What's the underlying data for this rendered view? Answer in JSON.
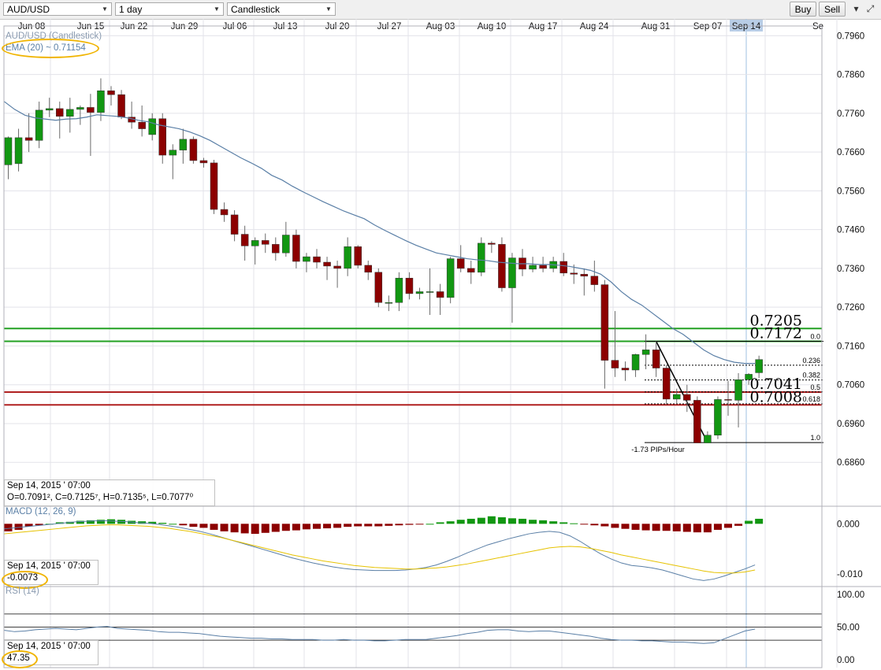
{
  "toolbar": {
    "symbol": "AUD/USD",
    "interval": "1 day",
    "chart_type": "Candlestick",
    "buy_label": "Buy",
    "sell_label": "Sell"
  },
  "main_labels": {
    "title": "AUD/USD (Candlestick)",
    "ema": "EMA (20) ~ 0.71154"
  },
  "info_main": {
    "date": "Sep 14, 2015 ' 07:00",
    "ohlc": "O=0.7091², C=0.7125⁷, H=0.7135⁵, L=0.7077⁰"
  },
  "macd_panel": {
    "label": "MACD (12, 26, 9)",
    "date": "Sep 14, 2015 ' 07:00",
    "value": "-0.0073"
  },
  "rsi_panel": {
    "label": "RSI (14)",
    "date": "Sep 14, 2015 ' 07:00",
    "value": "47.35"
  },
  "colors": {
    "bull": "#129712",
    "bear": "#8c0000",
    "ema": "#5a7fa6",
    "signal": "#e6c200",
    "support": "#b02020",
    "resistance": "#22a022",
    "highlight": "#f0b400"
  },
  "chart_data": {
    "type": "candlestick",
    "title": "AUD/USD (Candlestick)",
    "interval": "1 day",
    "x_tick_labels": [
      "Jun 08",
      "Jun 15",
      "Jun 22",
      "Jun 29",
      "Jul 06",
      "Jul 13",
      "Jul 20",
      "Jul 27",
      "Aug 03",
      "Aug 10",
      "Aug 17",
      "Aug 24",
      "Aug 31",
      "Sep 07",
      "Sep 14",
      "Se"
    ],
    "y_ticks": [
      "0.7960",
      "0.7860",
      "0.7760",
      "0.7660",
      "0.7560",
      "0.7460",
      "0.7360",
      "0.7260",
      "0.7160",
      "0.7060",
      "0.6960",
      "0.6860"
    ],
    "ylim": [
      0.683,
      0.7985
    ],
    "candles": [
      {
        "o": 0.7627,
        "h": 0.77,
        "l": 0.759,
        "c": 0.7697
      },
      {
        "o": 0.763,
        "h": 0.772,
        "l": 0.761,
        "c": 0.7697
      },
      {
        "o": 0.7697,
        "h": 0.776,
        "l": 0.766,
        "c": 0.769
      },
      {
        "o": 0.769,
        "h": 0.779,
        "l": 0.767,
        "c": 0.7768
      },
      {
        "o": 0.7768,
        "h": 0.78,
        "l": 0.775,
        "c": 0.7772
      },
      {
        "o": 0.7772,
        "h": 0.779,
        "l": 0.7695,
        "c": 0.7752
      },
      {
        "o": 0.7752,
        "h": 0.78,
        "l": 0.771,
        "c": 0.777
      },
      {
        "o": 0.777,
        "h": 0.778,
        "l": 0.773,
        "c": 0.7775
      },
      {
        "o": 0.7775,
        "h": 0.781,
        "l": 0.765,
        "c": 0.7762
      },
      {
        "o": 0.7762,
        "h": 0.785,
        "l": 0.774,
        "c": 0.7818
      },
      {
        "o": 0.7818,
        "h": 0.783,
        "l": 0.778,
        "c": 0.7808
      },
      {
        "o": 0.7808,
        "h": 0.782,
        "l": 0.7745,
        "c": 0.775
      },
      {
        "o": 0.775,
        "h": 0.779,
        "l": 0.772,
        "c": 0.7737
      },
      {
        "o": 0.7737,
        "h": 0.778,
        "l": 0.77,
        "c": 0.772
      },
      {
        "o": 0.7705,
        "h": 0.776,
        "l": 0.769,
        "c": 0.7746
      },
      {
        "o": 0.7746,
        "h": 0.776,
        "l": 0.763,
        "c": 0.7652
      },
      {
        "o": 0.7652,
        "h": 0.768,
        "l": 0.759,
        "c": 0.7665
      },
      {
        "o": 0.7665,
        "h": 0.772,
        "l": 0.763,
        "c": 0.7693
      },
      {
        "o": 0.7693,
        "h": 0.77,
        "l": 0.763,
        "c": 0.7638
      },
      {
        "o": 0.7638,
        "h": 0.7645,
        "l": 0.762,
        "c": 0.7632
      },
      {
        "o": 0.7632,
        "h": 0.764,
        "l": 0.75,
        "c": 0.7512
      },
      {
        "o": 0.7512,
        "h": 0.753,
        "l": 0.748,
        "c": 0.7498
      },
      {
        "o": 0.7498,
        "h": 0.751,
        "l": 0.743,
        "c": 0.7448
      },
      {
        "o": 0.7448,
        "h": 0.747,
        "l": 0.738,
        "c": 0.7418
      },
      {
        "o": 0.7418,
        "h": 0.744,
        "l": 0.737,
        "c": 0.7432
      },
      {
        "o": 0.7432,
        "h": 0.745,
        "l": 0.74,
        "c": 0.7422
      },
      {
        "o": 0.7422,
        "h": 0.744,
        "l": 0.738,
        "c": 0.74
      },
      {
        "o": 0.74,
        "h": 0.748,
        "l": 0.739,
        "c": 0.7446
      },
      {
        "o": 0.7446,
        "h": 0.746,
        "l": 0.736,
        "c": 0.7378
      },
      {
        "o": 0.7378,
        "h": 0.74,
        "l": 0.735,
        "c": 0.739
      },
      {
        "o": 0.739,
        "h": 0.741,
        "l": 0.736,
        "c": 0.7376
      },
      {
        "o": 0.7376,
        "h": 0.739,
        "l": 0.733,
        "c": 0.7366
      },
      {
        "o": 0.7366,
        "h": 0.738,
        "l": 0.731,
        "c": 0.736
      },
      {
        "o": 0.736,
        "h": 0.744,
        "l": 0.734,
        "c": 0.7416
      },
      {
        "o": 0.7416,
        "h": 0.742,
        "l": 0.736,
        "c": 0.7368
      },
      {
        "o": 0.7368,
        "h": 0.738,
        "l": 0.733,
        "c": 0.735
      },
      {
        "o": 0.735,
        "h": 0.736,
        "l": 0.726,
        "c": 0.7272
      },
      {
        "o": 0.7272,
        "h": 0.729,
        "l": 0.725,
        "c": 0.7272
      },
      {
        "o": 0.7272,
        "h": 0.735,
        "l": 0.725,
        "c": 0.7335
      },
      {
        "o": 0.7335,
        "h": 0.735,
        "l": 0.728,
        "c": 0.7295
      },
      {
        "o": 0.7295,
        "h": 0.731,
        "l": 0.728,
        "c": 0.73
      },
      {
        "o": 0.73,
        "h": 0.736,
        "l": 0.724,
        "c": 0.73
      },
      {
        "o": 0.73,
        "h": 0.732,
        "l": 0.724,
        "c": 0.7285
      },
      {
        "o": 0.7285,
        "h": 0.739,
        "l": 0.727,
        "c": 0.7385
      },
      {
        "o": 0.7385,
        "h": 0.742,
        "l": 0.735,
        "c": 0.736
      },
      {
        "o": 0.736,
        "h": 0.738,
        "l": 0.732,
        "c": 0.735
      },
      {
        "o": 0.735,
        "h": 0.744,
        "l": 0.734,
        "c": 0.7425
      },
      {
        "o": 0.7425,
        "h": 0.743,
        "l": 0.74,
        "c": 0.7422
      },
      {
        "o": 0.7422,
        "h": 0.744,
        "l": 0.73,
        "c": 0.731
      },
      {
        "o": 0.731,
        "h": 0.74,
        "l": 0.722,
        "c": 0.7387
      },
      {
        "o": 0.7387,
        "h": 0.741,
        "l": 0.734,
        "c": 0.7358
      },
      {
        "o": 0.7358,
        "h": 0.739,
        "l": 0.735,
        "c": 0.7368
      },
      {
        "o": 0.7368,
        "h": 0.739,
        "l": 0.735,
        "c": 0.736
      },
      {
        "o": 0.736,
        "h": 0.739,
        "l": 0.735,
        "c": 0.7378
      },
      {
        "o": 0.7378,
        "h": 0.74,
        "l": 0.734,
        "c": 0.7348
      },
      {
        "o": 0.7348,
        "h": 0.737,
        "l": 0.732,
        "c": 0.7345
      },
      {
        "o": 0.7345,
        "h": 0.736,
        "l": 0.729,
        "c": 0.734
      },
      {
        "o": 0.734,
        "h": 0.738,
        "l": 0.73,
        "c": 0.7318
      },
      {
        "o": 0.7318,
        "h": 0.733,
        "l": 0.705,
        "c": 0.7123
      },
      {
        "o": 0.7123,
        "h": 0.725,
        "l": 0.708,
        "c": 0.7103
      },
      {
        "o": 0.7103,
        "h": 0.712,
        "l": 0.707,
        "c": 0.7098
      },
      {
        "o": 0.7098,
        "h": 0.714,
        "l": 0.708,
        "c": 0.7138
      },
      {
        "o": 0.7138,
        "h": 0.719,
        "l": 0.71,
        "c": 0.715
      },
      {
        "o": 0.715,
        "h": 0.7172,
        "l": 0.708,
        "c": 0.7103
      },
      {
        "o": 0.7103,
        "h": 0.711,
        "l": 0.701,
        "c": 0.7023
      },
      {
        "o": 0.7023,
        "h": 0.705,
        "l": 0.701,
        "c": 0.7035
      },
      {
        "o": 0.7035,
        "h": 0.706,
        "l": 0.699,
        "c": 0.702
      },
      {
        "o": 0.702,
        "h": 0.703,
        "l": 0.691,
        "c": 0.691
      },
      {
        "o": 0.691,
        "h": 0.694,
        "l": 0.691,
        "c": 0.693
      },
      {
        "o": 0.693,
        "h": 0.703,
        "l": 0.692,
        "c": 0.7022
      },
      {
        "o": 0.7022,
        "h": 0.707,
        "l": 0.698,
        "c": 0.702
      },
      {
        "o": 0.702,
        "h": 0.709,
        "l": 0.695,
        "c": 0.7073
      },
      {
        "o": 0.7073,
        "h": 0.709,
        "l": 0.706,
        "c": 0.7087
      },
      {
        "o": 0.7091,
        "h": 0.7135,
        "l": 0.7077,
        "c": 0.7125
      }
    ],
    "ema20": [
      0.779,
      0.777,
      0.7755,
      0.7748,
      0.7745,
      0.7742,
      0.7745,
      0.7746,
      0.775,
      0.7756,
      0.7754,
      0.7752,
      0.7748,
      0.7742,
      0.7738,
      0.773,
      0.7725,
      0.772,
      0.7712,
      0.7702,
      0.769,
      0.7675,
      0.766,
      0.7645,
      0.7632,
      0.7618,
      0.76,
      0.7588,
      0.7572,
      0.7558,
      0.7545,
      0.7532,
      0.752,
      0.7508,
      0.7498,
      0.7488,
      0.7472,
      0.7458,
      0.7445,
      0.7432,
      0.742,
      0.741,
      0.74,
      0.7395,
      0.739,
      0.7385,
      0.7382,
      0.738,
      0.7376,
      0.7374,
      0.7372,
      0.7372,
      0.737,
      0.737,
      0.7368,
      0.7365,
      0.736,
      0.7355,
      0.7345,
      0.7325,
      0.73,
      0.728,
      0.7265,
      0.7245,
      0.7225,
      0.7205,
      0.719,
      0.717,
      0.715,
      0.7135,
      0.7125,
      0.7118,
      0.7115,
      0.7115
    ],
    "horizontal_levels": [
      {
        "value": 0.7205,
        "label": "0.7205",
        "color": "green"
      },
      {
        "value": 0.7172,
        "label": "0.7172",
        "color": "green"
      },
      {
        "value": 0.7041,
        "label": "0.7041",
        "color": "red"
      },
      {
        "value": 0.7008,
        "label": "0.7008",
        "color": "red"
      }
    ],
    "fibonacci": {
      "high": 0.7172,
      "low": 0.6911,
      "levels": [
        {
          "ratio": 0.0,
          "label": "0.0"
        },
        {
          "ratio": 0.236,
          "label": "0.236"
        },
        {
          "ratio": 0.382,
          "label": "0.382"
        },
        {
          "ratio": 0.5,
          "label": "0.5"
        },
        {
          "ratio": 0.618,
          "label": "0.618"
        },
        {
          "ratio": 1.0,
          "label": "1.0"
        }
      ]
    },
    "trendline": {
      "from_candle": 63,
      "from_value": 0.7172,
      "to_candle": 68,
      "to_value": 0.6911,
      "label": "-1.73 PIPs/Hour"
    },
    "macd": {
      "label": "MACD (12, 26, 9)",
      "yticks": [
        "0.000",
        "-0.010"
      ],
      "ylim": [
        -0.0125,
        0.0035
      ],
      "hist": [
        -0.0015,
        -0.0012,
        -0.0005,
        -0.0003,
        0.0,
        0.0003,
        0.0004,
        0.0006,
        0.0007,
        0.0008,
        0.0009,
        0.0008,
        0.0006,
        0.0005,
        0.0004,
        0.0002,
        0.0,
        -0.0003,
        -0.0006,
        -0.0008,
        -0.0012,
        -0.0015,
        -0.0017,
        -0.0019,
        -0.002,
        -0.0018,
        -0.0016,
        -0.0014,
        -0.0013,
        -0.0011,
        -0.001,
        -0.0009,
        -0.0008,
        -0.0006,
        -0.0005,
        -0.0005,
        -0.0005,
        -0.0004,
        -0.0003,
        -0.0002,
        -0.0001,
        0.0,
        0.0003,
        0.0005,
        0.0008,
        0.001,
        0.0012,
        0.0015,
        0.0013,
        0.0011,
        0.001,
        0.0008,
        0.0007,
        0.0005,
        0.0003,
        0.0001,
        -0.0001,
        -0.0003,
        -0.0005,
        -0.0008,
        -0.001,
        -0.0012,
        -0.0013,
        -0.0014,
        -0.0014,
        -0.0015,
        -0.0016,
        -0.0017,
        -0.0017,
        -0.0012,
        -0.0008,
        -0.0004,
        0.0006,
        0.001
      ],
      "macd_line": [
        -0.001,
        -0.0008,
        -0.0006,
        -0.0004,
        -0.0002,
        0.0,
        0.0002,
        0.0004,
        0.0005,
        0.0006,
        0.0006,
        0.0005,
        0.0004,
        0.0002,
        0.0001,
        -0.0001,
        -0.0004,
        -0.0007,
        -0.0011,
        -0.0015,
        -0.002,
        -0.0026,
        -0.0032,
        -0.0038,
        -0.0044,
        -0.005,
        -0.0056,
        -0.0062,
        -0.0068,
        -0.0073,
        -0.0078,
        -0.0082,
        -0.0086,
        -0.0089,
        -0.0091,
        -0.0092,
        -0.0093,
        -0.0093,
        -0.0093,
        -0.0092,
        -0.009,
        -0.0087,
        -0.0082,
        -0.0075,
        -0.0067,
        -0.0058,
        -0.005,
        -0.0042,
        -0.0036,
        -0.003,
        -0.0025,
        -0.002,
        -0.0017,
        -0.0015,
        -0.0017,
        -0.0024,
        -0.0035,
        -0.0048,
        -0.006,
        -0.007,
        -0.0078,
        -0.0083,
        -0.0085,
        -0.0088,
        -0.0092,
        -0.0098,
        -0.0104,
        -0.011,
        -0.0113,
        -0.011,
        -0.0104,
        -0.0097,
        -0.009,
        -0.0082
      ],
      "signal_line": [
        -0.002,
        -0.0018,
        -0.0016,
        -0.0014,
        -0.0012,
        -0.001,
        -0.0008,
        -0.0006,
        -0.0004,
        -0.0003,
        -0.0002,
        -0.0002,
        -0.0003,
        -0.0004,
        -0.0005,
        -0.0007,
        -0.0009,
        -0.0012,
        -0.0015,
        -0.0019,
        -0.0023,
        -0.0027,
        -0.0032,
        -0.0037,
        -0.0042,
        -0.0047,
        -0.0052,
        -0.0057,
        -0.0062,
        -0.0066,
        -0.007,
        -0.0074,
        -0.0077,
        -0.008,
        -0.0083,
        -0.0085,
        -0.0087,
        -0.0088,
        -0.0089,
        -0.009,
        -0.009,
        -0.0089,
        -0.0088,
        -0.0086,
        -0.0083,
        -0.008,
        -0.0076,
        -0.0072,
        -0.0068,
        -0.0064,
        -0.006,
        -0.0056,
        -0.0052,
        -0.0048,
        -0.0046,
        -0.0045,
        -0.0046,
        -0.0049,
        -0.0053,
        -0.0057,
        -0.0062,
        -0.0066,
        -0.007,
        -0.0074,
        -0.0078,
        -0.0082,
        -0.0086,
        -0.009,
        -0.0094,
        -0.0097,
        -0.0098,
        -0.0098,
        -0.0096,
        -0.0092
      ]
    },
    "rsi": {
      "label": "RSI (14)",
      "yticks": [
        "100.00",
        "50.00",
        "0.00"
      ],
      "ylim": [
        0,
        100
      ],
      "overbought": 70,
      "oversold": 30,
      "values": [
        45,
        43,
        44,
        46,
        47,
        48,
        47,
        46,
        48,
        50,
        51,
        48,
        47,
        46,
        45,
        43,
        42,
        42,
        41,
        40,
        38,
        36,
        35,
        34,
        33,
        33,
        32,
        32,
        31,
        31,
        31,
        30,
        30,
        31,
        30,
        30,
        29,
        29,
        30,
        31,
        31,
        31,
        33,
        35,
        37,
        40,
        42,
        45,
        46,
        46,
        44,
        43,
        44,
        44,
        42,
        40,
        38,
        36,
        33,
        31,
        30,
        30,
        29,
        29,
        28,
        27,
        27,
        26,
        25,
        26,
        32,
        38,
        44,
        47
      ]
    }
  }
}
